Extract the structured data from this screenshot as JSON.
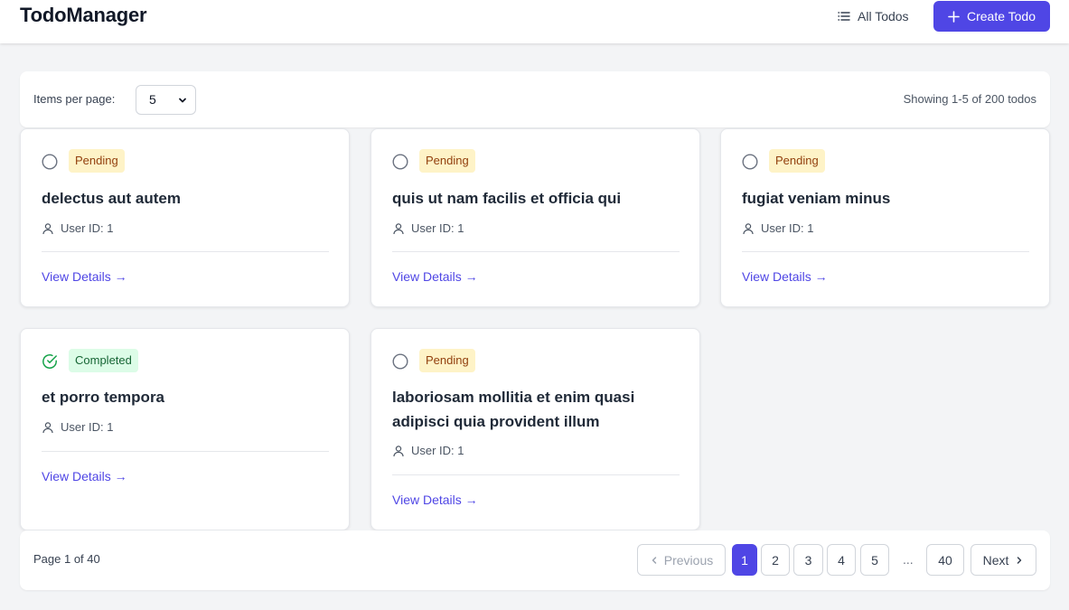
{
  "header": {
    "brand": "TodoManager",
    "nav_all_label": "All Todos",
    "create_label": "Create Todo",
    "accent_color": "#4f46e5"
  },
  "toolbar": {
    "items_per_page_label": "Items per page:",
    "items_per_page_value": "5",
    "showing_text": "Showing 1-5 of 200 todos"
  },
  "todos": [
    {
      "status": "pending",
      "status_label": "Pending",
      "title": "delectus aut autem",
      "user": "User ID: 1",
      "link": "View Details →"
    },
    {
      "status": "pending",
      "status_label": "Pending",
      "title": "quis ut nam facilis et officia qui",
      "user": "User ID: 1",
      "link": "View Details →"
    },
    {
      "status": "pending",
      "status_label": "Pending",
      "title": "fugiat veniam minus",
      "user": "User ID: 1",
      "link": "View Details →"
    },
    {
      "status": "completed",
      "status_label": "Completed",
      "title": "et porro tempora",
      "user": "User ID: 1",
      "link": "View Details →"
    },
    {
      "status": "pending",
      "status_label": "Pending",
      "title": "laboriosam mollitia et enim quasi adipisci quia provident illum",
      "user": "User ID: 1",
      "link": "View Details →"
    }
  ],
  "pagination": {
    "page_text": "Page 1 of 40",
    "previous_label": "Previous",
    "next_label": "Next",
    "pages": [
      "1",
      "2",
      "3",
      "4",
      "5"
    ],
    "ellipsis": "...",
    "last_page": "40",
    "current_page": "1"
  },
  "colors": {
    "pending_bg": "#fef3c7",
    "pending_text": "#92400e",
    "completed_bg": "#dcfce7",
    "completed_text": "#166534",
    "check_green": "#16a34a"
  }
}
